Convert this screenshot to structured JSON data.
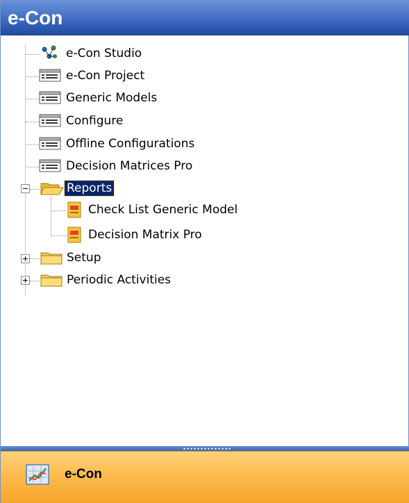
{
  "header": {
    "title": "e-Con"
  },
  "tree": {
    "items": [
      {
        "label": "e-Con Studio",
        "icon": "network-icon"
      },
      {
        "label": "e-Con Project",
        "icon": "list-window-icon"
      },
      {
        "label": "Generic Models",
        "icon": "list-window-icon"
      },
      {
        "label": "Configure",
        "icon": "list-window-icon"
      },
      {
        "label": "Offline Configurations",
        "icon": "list-window-icon"
      },
      {
        "label": "Decision Matrices Pro",
        "icon": "list-window-icon"
      },
      {
        "label": "Reports",
        "icon": "folder-open-icon",
        "expanded": true,
        "selected": true,
        "children": [
          {
            "label": "Check List Generic Model",
            "icon": "report-icon"
          },
          {
            "label": "Decision Matrix Pro",
            "icon": "report-icon"
          }
        ]
      },
      {
        "label": "Setup",
        "icon": "folder-icon",
        "expanded": false
      },
      {
        "label": "Periodic Activities",
        "icon": "folder-icon",
        "expanded": false
      }
    ]
  },
  "bottom": {
    "label": "e-Con",
    "icon": "chart-window-icon"
  },
  "colors": {
    "header": "#3a66bf",
    "bottom_bar": "#f9b440",
    "selection": "#0a246a"
  }
}
